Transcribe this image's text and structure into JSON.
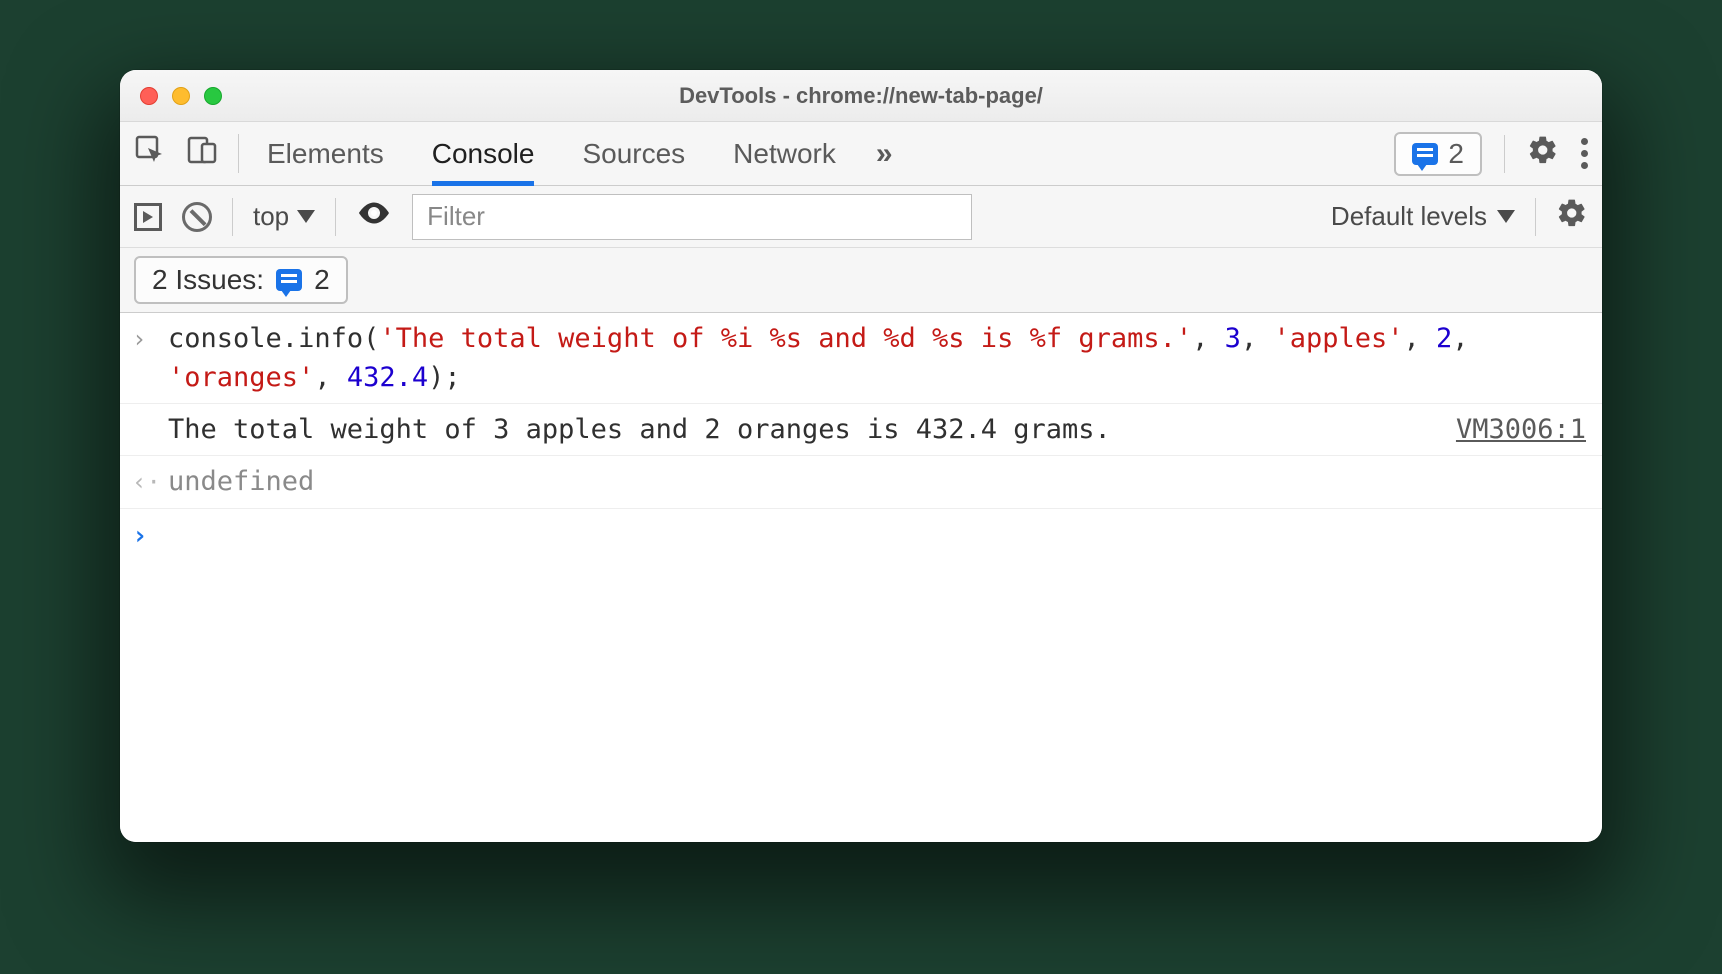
{
  "window": {
    "title": "DevTools - chrome://new-tab-page/"
  },
  "tabs": {
    "items": [
      "Elements",
      "Console",
      "Sources",
      "Network"
    ],
    "active_index": 1,
    "overflow_glyph": "»"
  },
  "header_issues": {
    "count": "2"
  },
  "console_toolbar": {
    "context": "top",
    "filter_placeholder": "Filter",
    "levels_label": "Default levels"
  },
  "issues_bar": {
    "label": "2 Issues:",
    "count": "2"
  },
  "console": {
    "input_gutter": "›",
    "output_gutter": " ",
    "result_gutter": "‹·",
    "prompt_gutter": "›",
    "input_tokens": {
      "obj": "console",
      "dot": ".",
      "method": "info",
      "open": "(",
      "str1": "'The total weight of %i %s and %d %s is %f grams.'",
      "c1": ", ",
      "n1": "3",
      "c2": ", ",
      "str2": "'apples'",
      "c3": ", ",
      "n2": "2",
      "c4": ", ",
      "str3": "'oranges'",
      "c5": ", ",
      "n3": "432.4",
      "close": ");"
    },
    "output_text": "The total weight of 3 apples and 2 oranges is 432.4 grams.",
    "output_source": "VM3006:1",
    "result_text": "undefined"
  }
}
